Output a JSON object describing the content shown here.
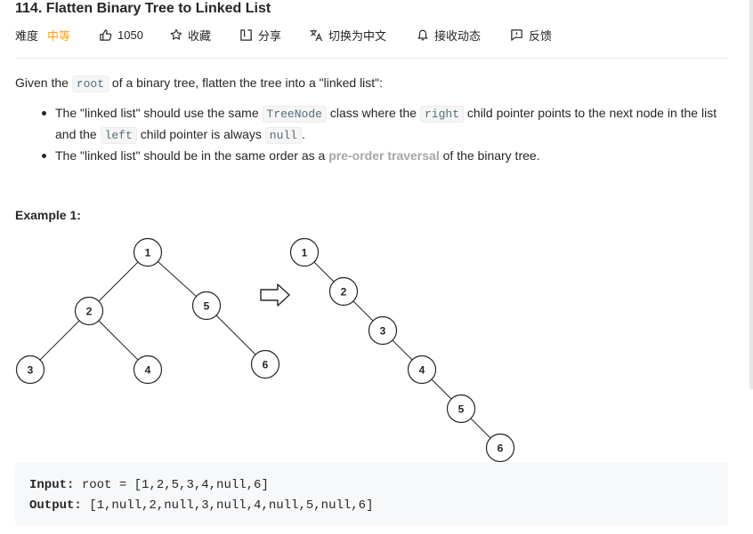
{
  "problem": {
    "title": "114. Flatten Binary Tree to Linked List"
  },
  "meta": {
    "difficulty_label": "难度",
    "difficulty_value": "中等",
    "likes": "1050",
    "favorite_label": "收藏",
    "share_label": "分享",
    "translate_label": "切换为中文",
    "subscribe_label": "接收动态",
    "feedback_label": "反馈",
    "difficulty_color": "#ffa116"
  },
  "description": {
    "intro_1": "Given the ",
    "intro_code": "root",
    "intro_2": " of a binary tree, flatten the tree into a \"linked list\":",
    "b1_1": "The \"linked list\" should use the same ",
    "b1_code1": "TreeNode",
    "b1_2": " class where the ",
    "b1_code2": "right",
    "b1_3": " child pointer points to the next node in the list and the ",
    "b1_code3": "left",
    "b1_4": " child pointer is always ",
    "b1_code4": "null",
    "b1_5": ".",
    "b2_1": "The \"linked list\" should be in the same order as a ",
    "b2_link": "pre-order traversal",
    "b2_2": " of the binary tree."
  },
  "example": {
    "title": "Example 1:",
    "input_label": "Input:",
    "input_value": "root = [1,2,5,3,4,null,6]",
    "output_label": "Output:",
    "output_value": "[1,null,2,null,3,null,4,null,5,null,6]"
  },
  "diagram": {
    "left_tree_nodes": [
      "1",
      "2",
      "5",
      "3",
      "4",
      "6"
    ],
    "right_list_nodes": [
      "1",
      "2",
      "3",
      "4",
      "5",
      "6"
    ]
  },
  "icons": [
    "thumb-up-icon",
    "star-icon",
    "share-icon",
    "translate-icon",
    "bell-icon",
    "feedback-icon",
    "arrow-right-icon"
  ]
}
